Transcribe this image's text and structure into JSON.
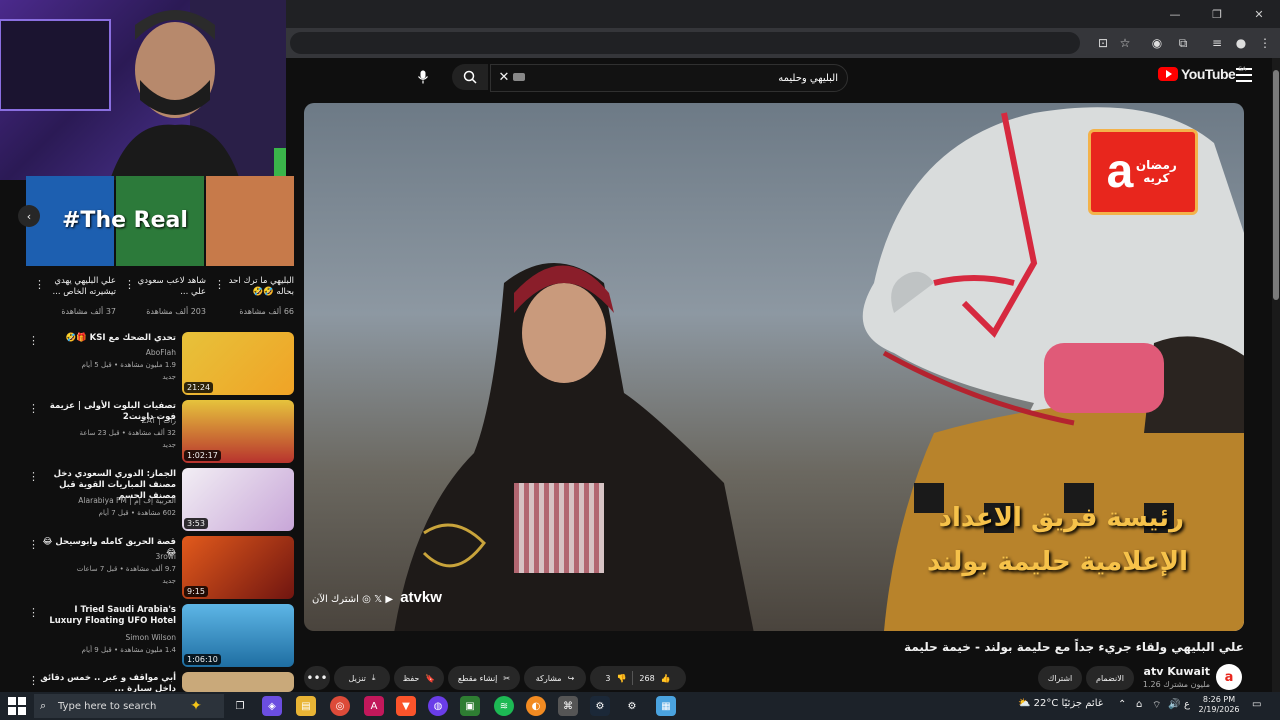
{
  "window": {
    "min": "—",
    "restore": "❐",
    "close": "✕"
  },
  "youtube": {
    "logo_word": "YouTube",
    "country": "SA"
  },
  "search": {
    "value": "البليهي وحليمه"
  },
  "player": {
    "caption_line1": "رئيسة فريق الاعداد",
    "caption_line2": "الإعلامية حليمة بولند",
    "badge_text": "رمضان كريه",
    "badge_letter": "a",
    "watermark_subscribe": "اشترك الآن",
    "watermark_handle": "atvkw"
  },
  "video": {
    "title": "علي البليهي ولقاء جريء جداً مع حليمة بولند - خيمة حليمة",
    "channel": "atv Kuwait",
    "subs": "1.26 مليون مشترك",
    "join_label": "الانضمام",
    "subscribe_label": "اشتراك",
    "likes": "268",
    "dislikes": "3",
    "share_label": "مشاركة",
    "clip_label": "إنشاء مقطع",
    "save_label": "حفظ",
    "download_label": "تنزيل",
    "more_label": "•••"
  },
  "shorts": [
    {
      "title": "البليهي ما ترك احد بحاله 🤣🤣",
      "views": "66 ألف مشاهدة"
    },
    {
      "title": "شاهد لاعب سعودي علي ...",
      "views": "203 ألف مشاهدة"
    },
    {
      "title": "علي البليهي يهدي تيشيرته الخاص ...",
      "views": "37 ألف مشاهدة"
    }
  ],
  "shorts_overlay": "#The Real",
  "related": [
    {
      "title": "تحدي الضحك مع KSI 🎁🤣",
      "channel": "AboFlah",
      "meta": "1.9 مليون مشاهدة • قبل 5 أيام",
      "badge": "جديد",
      "duration": "21:24"
    },
    {
      "title": "تصفيات البلوت الأولى | عزيمة فوت داونت2",
      "channel": "ZAT | زات",
      "meta": "32 ألف مشاهدة • قبل 23 ساعة",
      "badge": "جديد",
      "duration": "1:02:17"
    },
    {
      "title": "الجماز: الدوري السعودي دخل مصنف المباريات القوية قبل مصنف الحسم",
      "channel": "Alarabiya FM | العربية إف إم",
      "meta": "602 مشاهدة • قبل 7 أيام",
      "badge": "",
      "duration": "3:53"
    },
    {
      "title": "قصة الحريق كامله وابوسيحل 😂😂",
      "channel": "3rowi",
      "meta": "9.7 ألف مشاهدة • قبل 7 ساعات",
      "badge": "جديد",
      "duration": "9:15"
    },
    {
      "title": "I Tried Saudi Arabia's Luxury Floating UFO Hotel",
      "channel": "Simon Wilson",
      "meta": "1.4 مليون مشاهدة • قبل 9 أيام",
      "badge": "",
      "duration": "1:06:10"
    },
    {
      "title": "أبي مواقف و عبر .. خمس دقائق داخل سيارة ...",
      "channel": "",
      "meta": "",
      "badge": "",
      "duration": ""
    }
  ],
  "taskbar": {
    "search_placeholder": "Type here to search",
    "weather_temp": "22°C",
    "weather_text": "غائم جزئيًا",
    "lang": "ع",
    "time": "8:26 PM",
    "date": "2/19/2026"
  }
}
